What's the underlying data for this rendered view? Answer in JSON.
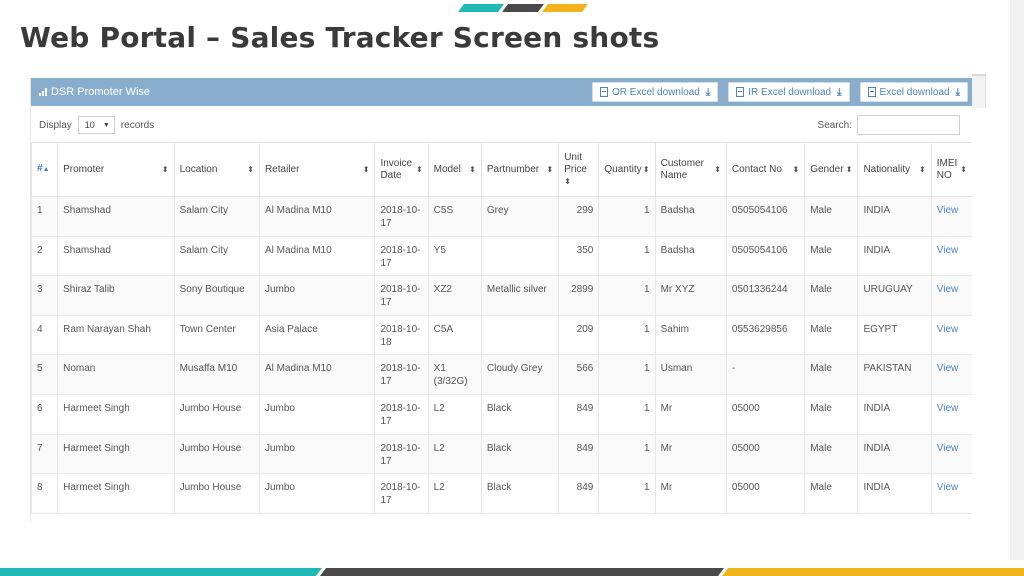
{
  "slide": {
    "title": "Web Portal  – Sales Tracker Screen shots"
  },
  "colors": {
    "teal": "#1fb9b6",
    "dark": "#4a4a4a",
    "gold": "#f1b41c",
    "header": "#89aecd",
    "link": "#4a86c5"
  },
  "panel": {
    "title": "DSR Promoter Wise",
    "title_icon": "bar-chart-icon",
    "buttons": [
      {
        "label": "OR Excel download",
        "icon": "file-icon",
        "action_icon": "download-icon"
      },
      {
        "label": "IR Excel download",
        "icon": "file-icon",
        "action_icon": "download-icon"
      },
      {
        "label": "Excel download",
        "icon": "file-icon",
        "action_icon": "download-icon"
      }
    ]
  },
  "controls": {
    "display_label": "Display",
    "records_per_page": "10",
    "records_label": "records",
    "search_label": "Search:",
    "search_value": ""
  },
  "table": {
    "columns": [
      "#",
      "Promoter",
      "Location",
      "Retailer",
      "Invoice Date",
      "Model",
      "Partnumber",
      "Unit Price",
      "Quantity",
      "Customer Name",
      "Contact No",
      "Gender",
      "Nationality",
      "IMEI NO"
    ],
    "rows": [
      [
        "1",
        "Shamshad",
        "Salam City",
        "Al Madina M10",
        "2018-10-17",
        "C5S",
        "Grey",
        "299",
        "1",
        "Badsha",
        "0505054106",
        "Male",
        "INDIA",
        "View"
      ],
      [
        "2",
        "Shamshad",
        "Salam City",
        "Al Madina M10",
        "2018-10-17",
        "Y5",
        "",
        "350",
        "1",
        "Badsha",
        "0505054106",
        "Male",
        "INDIA",
        "View"
      ],
      [
        "3",
        "Shiraz Talib",
        "Sony Boutique",
        "Jumbo",
        "2018-10-17",
        "XZ2",
        "Metallic silver",
        "2899",
        "1",
        "Mr XYZ",
        "0501336244",
        "Male",
        "URUGUAY",
        "View"
      ],
      [
        "4",
        "Ram Narayan Shah",
        "Town Center",
        "Asia Palace",
        "2018-10-18",
        "C5A",
        "",
        "209",
        "1",
        "Sahim",
        "0553629856",
        "Male",
        "EGYPT",
        "View"
      ],
      [
        "5",
        "Noman",
        "Musaffa M10",
        "Al Madina M10",
        "2018-10-17",
        "X1 (3/32G)",
        "Cloudy Grey",
        "566",
        "1",
        "Usman",
        "-",
        "Male",
        "PAKISTAN",
        "View"
      ],
      [
        "6",
        "Harmeet Singh",
        "Jumbo House",
        "Jumbo",
        "2018-10-17",
        "L2",
        "Black",
        "849",
        "1",
        "Mr",
        "05000",
        "Male",
        "INDIA",
        "View"
      ],
      [
        "7",
        "Harmeet Singh",
        "Jumbo House",
        "Jumbo",
        "2018-10-17",
        "L2",
        "Black",
        "849",
        "1",
        "Mr",
        "05000",
        "Male",
        "INDIA",
        "View"
      ],
      [
        "8",
        "Harmeet Singh",
        "Jumbo House",
        "Jumbo",
        "2018-10-17",
        "L2",
        "Black",
        "849",
        "1",
        "Mr",
        "05000",
        "Male",
        "INDIA",
        "View"
      ]
    ]
  }
}
